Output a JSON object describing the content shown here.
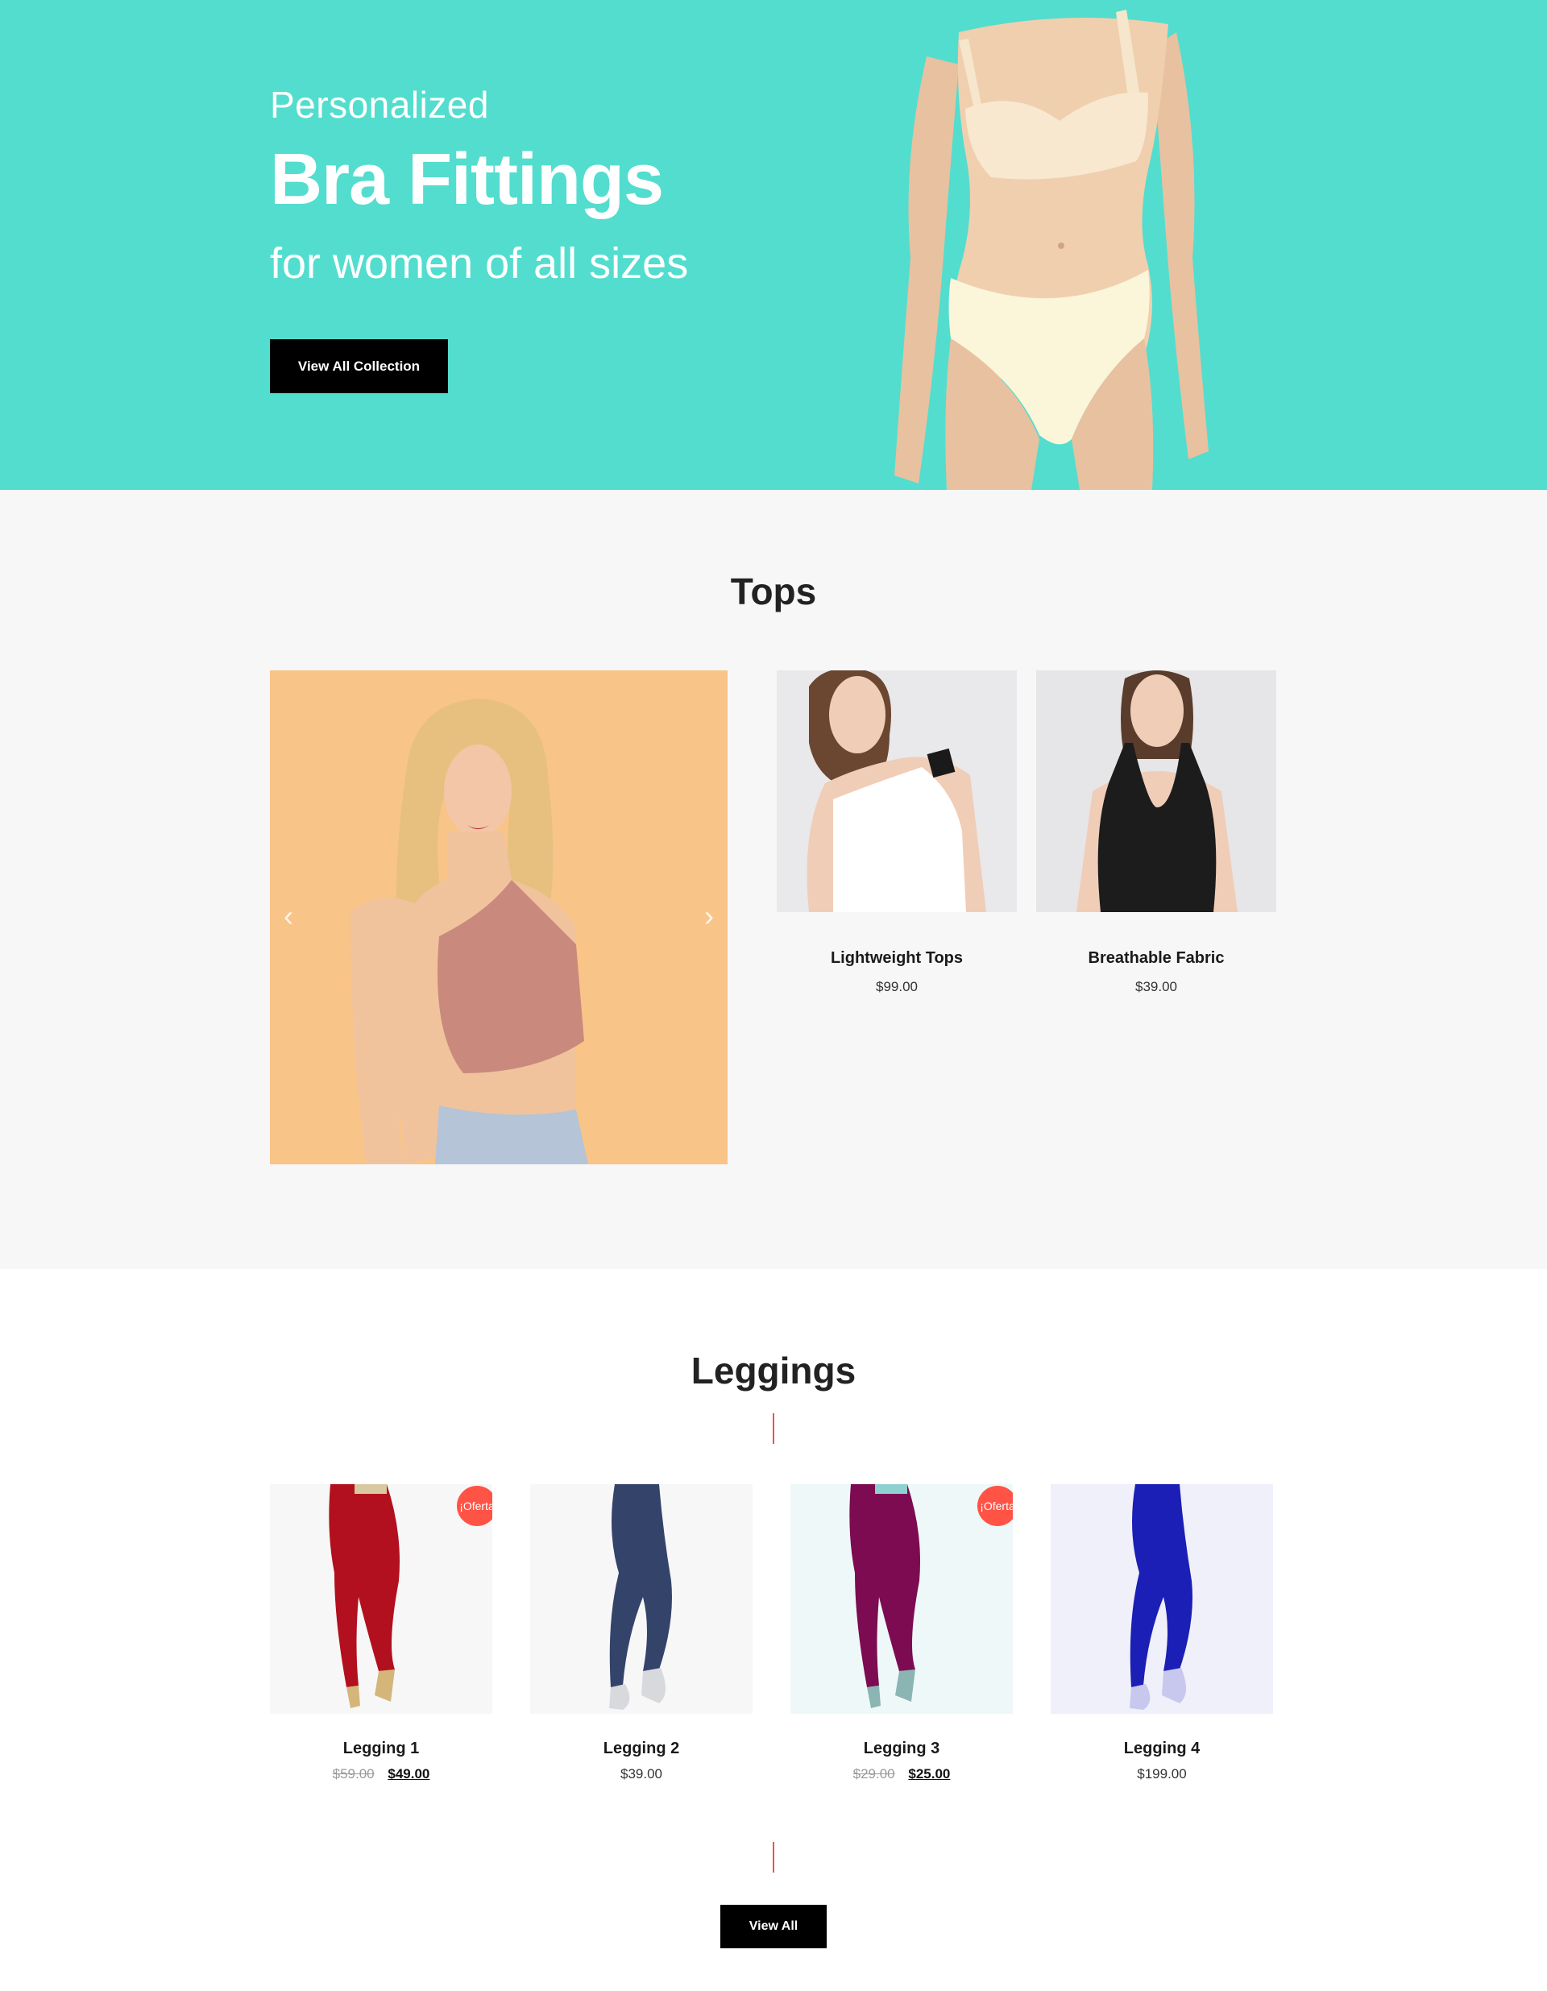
{
  "colors": {
    "hero_bg": "#53ddce",
    "section_bg": "#f7f7f7",
    "accent_red": "#ff5346",
    "button_bg": "#000000"
  },
  "hero": {
    "pre_title": "Personalized",
    "title": "Bra Fittings",
    "subtitle": "for women of all sizes",
    "button_label": "View All Collection"
  },
  "tops": {
    "title": "Tops",
    "carousel": {
      "prev_icon": "chevron-left-icon",
      "next_icon": "chevron-right-icon",
      "prev_glyph": "‹",
      "next_glyph": "›"
    },
    "products": [
      {
        "name": "Lightweight Tops",
        "price": "$99.00"
      },
      {
        "name": "Breathable Fabric",
        "price": "$39.00"
      }
    ]
  },
  "leggings": {
    "title": "Leggings",
    "products": [
      {
        "name": "Legging 1",
        "old_price": "$59.00",
        "price": "$49.00",
        "badge": "¡Oferta"
      },
      {
        "name": "Legging 2",
        "price": "$39.00"
      },
      {
        "name": "Legging 3",
        "old_price": "$29.00",
        "price": "$25.00",
        "badge": "¡Oferta"
      },
      {
        "name": "Legging 4",
        "price": "$199.00"
      }
    ],
    "view_all_label": "View All"
  }
}
